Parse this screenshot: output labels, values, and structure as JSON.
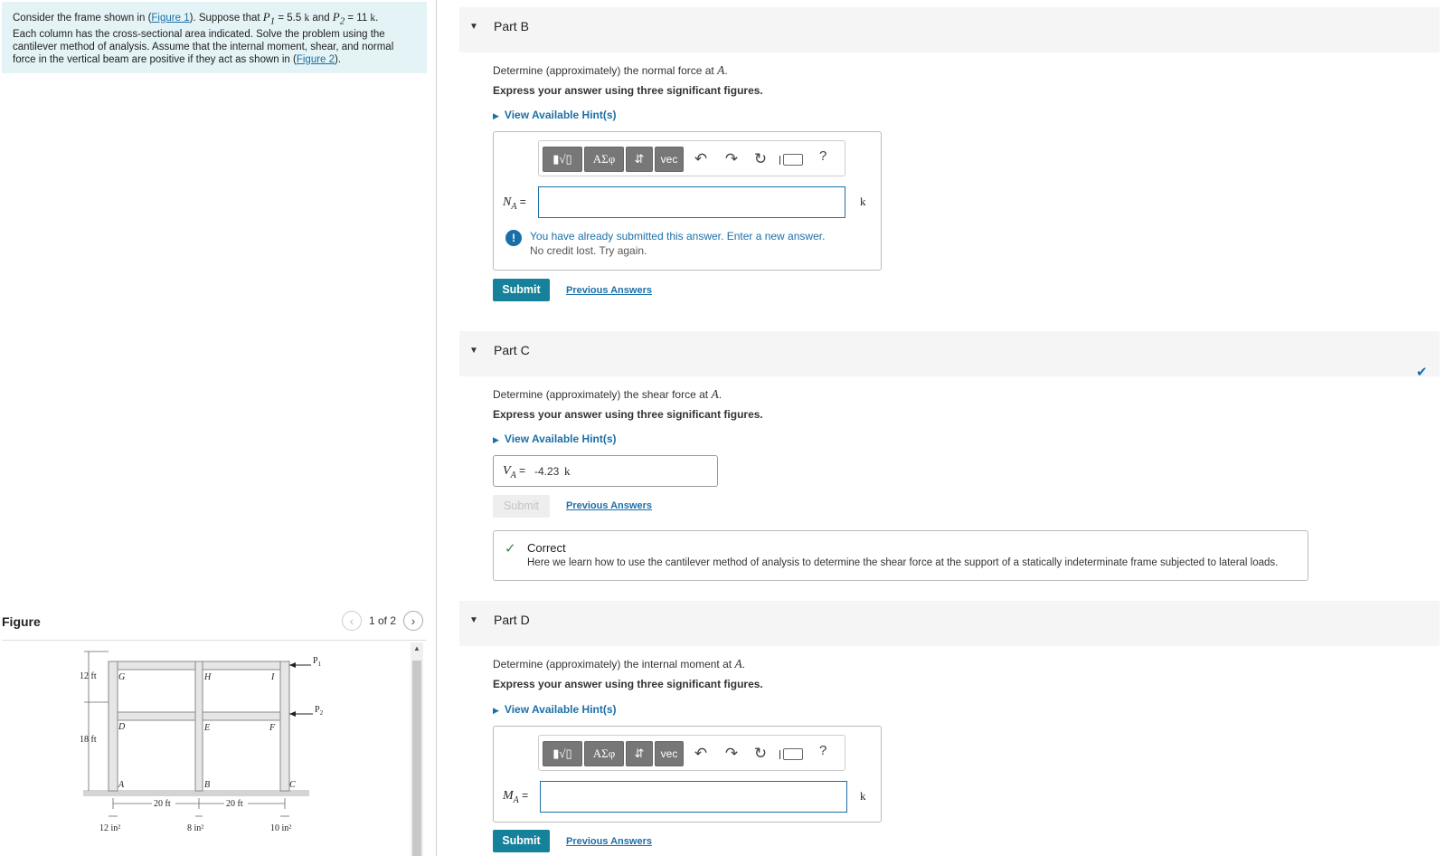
{
  "problem": {
    "intro": "Consider the frame shown in (",
    "figure1_link": "Figure 1",
    "after_fig1": "). Suppose that ",
    "p1_sym": "P",
    "p1_sub": "1",
    "p1_val": " = 5.5 ",
    "p1_unit": "k",
    "and": " and ",
    "p2_sym": "P",
    "p2_sub": "2",
    "p2_val": " = 11 ",
    "p2_unit": "k",
    "end1": ".",
    "line2": "Each column has the cross-sectional area indicated. Solve the problem using the",
    "line3": "cantilever method of analysis. Assume that the internal moment, shear, and normal",
    "line4_pre": "force in the vertical beam are positive if they act as shown in (",
    "figure2_link": "Figure 2",
    "line4_post": ")."
  },
  "figure": {
    "title": "Figure",
    "counter": "1 of 2",
    "prev_icon": "chevron-left-icon",
    "next_icon": "chevron-right-icon",
    "labels": {
      "G": "G",
      "H": "H",
      "I": "I",
      "D": "D",
      "E": "E",
      "F": "F",
      "A": "A",
      "B": "B",
      "C": "C",
      "P1": "P",
      "P1_sub": "1",
      "P2": "P",
      "P2_sub": "2",
      "h_top": "12 ft",
      "h_bot": "18 ft",
      "w_left": "20 ft",
      "w_right": "20 ft",
      "area_a": "12 in²",
      "area_b": "8 in²",
      "area_c": "10 in²"
    }
  },
  "parts": {
    "b": {
      "title": "Part B",
      "question_pre": "Determine (approximately) the normal force at ",
      "question_var": "A",
      "question_post": ".",
      "instruction": "Express your answer using three significant figures.",
      "hint": "View Available Hint(s)",
      "var_sym": "N",
      "var_sub": "A",
      "eq": " =",
      "input_value": "",
      "unit": "k",
      "warning": "You have already submitted this answer. Enter a new answer.",
      "warning_sub": "No credit lost. Try again.",
      "submit": "Submit",
      "previous": "Previous Answers"
    },
    "c": {
      "title": "Part C",
      "question_pre": "Determine (approximately) the shear force at ",
      "question_var": "A",
      "question_post": ".",
      "instruction": "Express your answer using three significant figures.",
      "hint": "View Available Hint(s)",
      "var_sym": "V",
      "var_sub": "A",
      "eq": " =",
      "answer_value": "-4.23",
      "unit": "k",
      "submit": "Submit",
      "previous": "Previous Answers",
      "correct_title": "Correct",
      "correct_detail": "Here we learn how to use the cantilever method of analysis to determine the shear force at the support of a statically indeterminate frame subjected to lateral loads."
    },
    "d": {
      "title": "Part D",
      "question_pre": "Determine (approximately) the internal moment at ",
      "question_var": "A",
      "question_post": ".",
      "instruction": "Express your answer using three significant figures.",
      "hint": "View Available Hint(s)",
      "var_sym": "M",
      "var_sub": "A",
      "eq": " =",
      "input_value": "",
      "unit": "k",
      "submit": "Submit",
      "previous": "Previous Answers"
    }
  },
  "toolbar": {
    "templates": "▮√▯",
    "greek": "ΑΣφ",
    "arrows": "⇵",
    "vec": "vec",
    "undo_icon": "undo-icon",
    "redo_icon": "redo-icon",
    "reset_icon": "reset-icon",
    "keyboard_icon": "keyboard-icon",
    "help": "?"
  },
  "colors": {
    "accent": "#16819a",
    "link": "#1b6fa8",
    "problem_bg": "#e4f3f6",
    "correct": "#2e8b3e"
  }
}
